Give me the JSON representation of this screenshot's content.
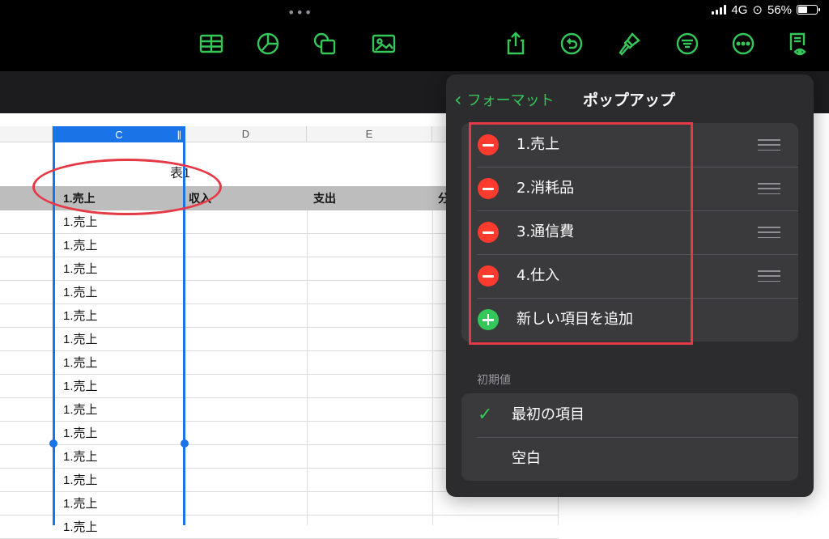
{
  "status": {
    "network": "4G",
    "battery_text": "56%",
    "battery_level": 0.56,
    "grabber": "•••"
  },
  "toolbar": {
    "icons": [
      "table-icon",
      "chart-icon",
      "shapes-icon",
      "media-icon",
      "share-icon",
      "undo-icon",
      "format-brush-icon",
      "organize-icon",
      "more-icon",
      "reader-view-icon"
    ],
    "accent": "#34c759"
  },
  "sheet": {
    "columns": {
      "c": "C",
      "d": "D",
      "e": "E"
    },
    "table_title": "表1",
    "headers": {
      "c": "1.売上",
      "d": "収入",
      "e": "支出",
      "f": "分"
    },
    "cells": [
      "1.売上",
      "1.売上",
      "1.売上",
      "1.売上",
      "1.売上",
      "1.売上",
      "1.売上",
      "1.売上",
      "1.売上",
      "1.売上",
      "1.売上",
      "1.売上",
      "1.売上",
      "1.売上"
    ],
    "selection_color": "#1b73e8",
    "annotation_color": "#e53945"
  },
  "popover": {
    "back_label": "フォーマット",
    "title": "ポップアップ",
    "items": [
      {
        "label": "1.売上"
      },
      {
        "label": "2.消耗品"
      },
      {
        "label": "3.通信費"
      },
      {
        "label": "4.仕入"
      }
    ],
    "add_label": "新しい項目を追加",
    "default_section_label": "初期値",
    "default_options": [
      {
        "label": "最初の項目",
        "selected": true
      },
      {
        "label": "空白",
        "selected": false
      }
    ],
    "check_glyph": "✓"
  }
}
